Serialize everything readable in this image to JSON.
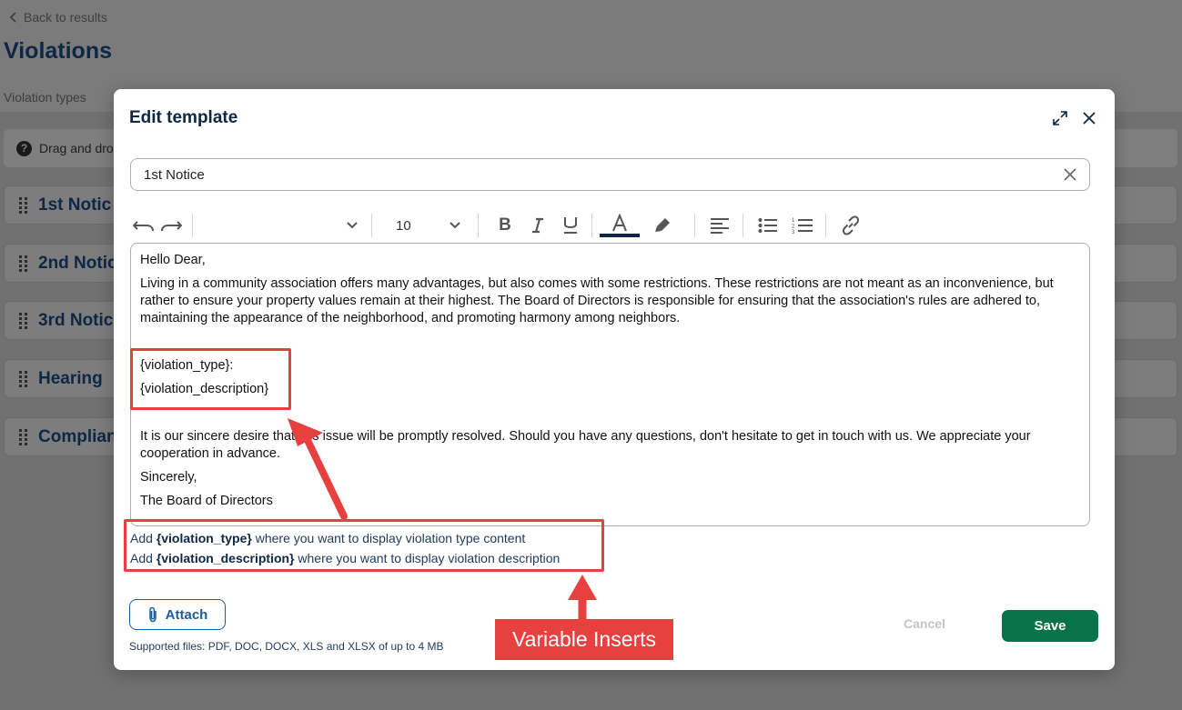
{
  "background": {
    "back_link": "Back to results",
    "page_title": "Violations",
    "tab_label": "Violation types",
    "info_text": "Drag and dro",
    "rows": [
      "1st Notic",
      "2nd Notic",
      "3rd Notic",
      "Hearing",
      "Complian"
    ]
  },
  "modal": {
    "title": "Edit template",
    "template_name": "1st Notice",
    "toolbar": {
      "font_size": "10",
      "text_color": "#0d2745"
    },
    "body": {
      "greeting": "Hello Dear,",
      "paragraph1": "Living in a community association offers many advantages, but also comes with some restrictions. These restrictions are not meant as an inconvenience, but rather to ensure your property values remain at their highest. The Board of Directors is responsible for ensuring that the association's rules are adhered to, maintaining the appearance of the neighborhood, and promoting harmony among neighbors.",
      "var_type": "{violation_type}:",
      "var_description": "{violation_description}",
      "paragraph2": "It is our sincere desire that this issue will be promptly resolved. Should you have any questions, don't hesitate to get in touch with us. We appreciate your cooperation in advance.",
      "closing": "Sincerely,",
      "signature": "The Board of Directors"
    },
    "hints": {
      "line1_prefix": "Add ",
      "line1_var": "{violation_type}",
      "line1_suffix": " where you want to display violation type content",
      "line2_prefix": "Add ",
      "line2_var": "{violation_description}",
      "line2_suffix": " where you want to display violation description"
    },
    "attach_label": "Attach",
    "supported_files": "Supported files: PDF, DOC, DOCX, XLS and XLSX of up to 4 MB",
    "cancel_label": "Cancel",
    "save_label": "Save"
  },
  "annotation": {
    "label": "Variable Inserts",
    "color": "#e6413f"
  },
  "colors": {
    "primary_navy": "#0d2745",
    "save_green": "#077349",
    "attach_blue": "#1c5c9c"
  }
}
